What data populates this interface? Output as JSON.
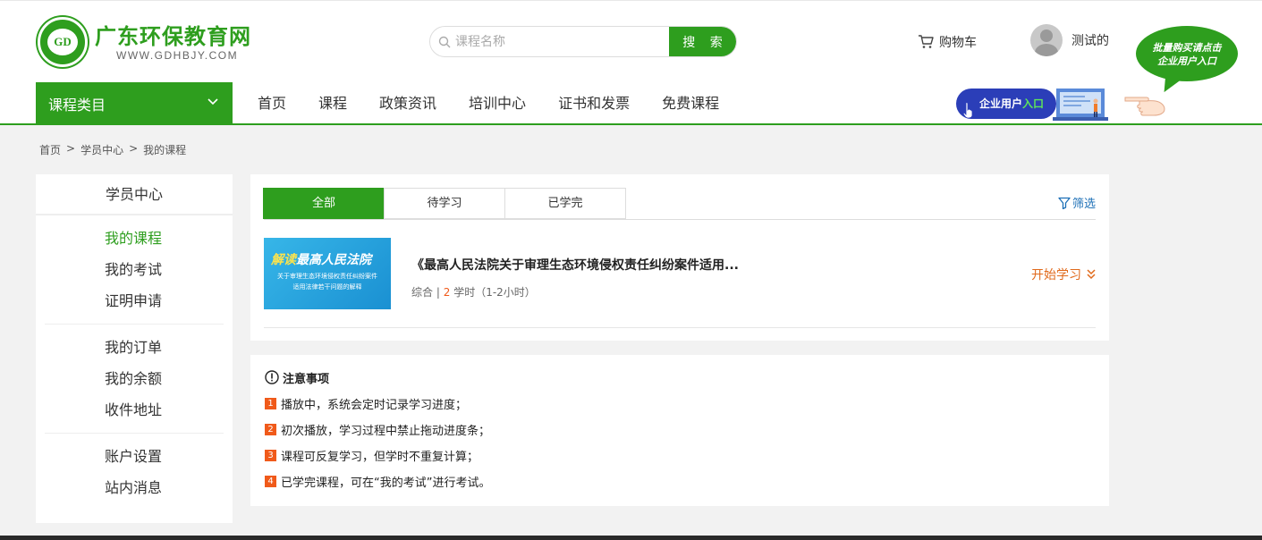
{
  "header": {
    "logo_title": "广东环保教育网",
    "logo_sub": "WWW.GDHBJY.COM",
    "logo_mark": "GD",
    "search_placeholder": "课程名称",
    "search_button": "搜 索",
    "cart_label": "购物车",
    "username": "测试的",
    "bubble_line1": "批量购买请点击",
    "bubble_line2": "企业用户入口",
    "enterprise_label": "企业用户",
    "enterprise_highlight": "入口"
  },
  "nav": {
    "category_label": "课程类目",
    "items": [
      "首页",
      "课程",
      "政策资讯",
      "培训中心",
      "证书和发票",
      "免费课程"
    ]
  },
  "breadcrumb": [
    "首页",
    ">",
    "学员中心",
    ">",
    "我的课程"
  ],
  "sidebar": {
    "title": "学员中心",
    "groups": [
      [
        "我的课程",
        "我的考试",
        "证明申请"
      ],
      [
        "我的订单",
        "我的余额",
        "收件地址"
      ],
      [
        "账户设置",
        "站内消息"
      ]
    ]
  },
  "tabs": [
    "全部",
    "待学习",
    "已学完"
  ],
  "filter_label": "筛选",
  "course": {
    "thumb_prefix": "解读",
    "thumb_title": "最高人民法院",
    "thumb_line1": "关于审理生态环境侵权责任纠纷案件",
    "thumb_line2": "适用法律若干问题的解释",
    "title": "《最高人民法院关于审理生态环境侵权责任纠纷案件适用...",
    "category": "综合",
    "separator": "|",
    "hours": "2",
    "hours_unit": "学时",
    "duration": "（1-2小时）",
    "action": "开始学习"
  },
  "notice": {
    "title": "注意事项",
    "items": [
      {
        "n": "1",
        "text": "播放中，系统会定时记录学习进度；"
      },
      {
        "n": "2",
        "text": "初次播放，学习过程中禁止拖动进度条；"
      },
      {
        "n": "3",
        "text": "课程可反复学习，但学时不重复计算；"
      },
      {
        "n": "4",
        "text": "已学完课程，可在“我的考试”进行考试。"
      }
    ]
  },
  "colors": {
    "brand_green": "#2e9e1e",
    "accent_orange": "#f05a1a",
    "link_blue": "#1c6fb6"
  }
}
